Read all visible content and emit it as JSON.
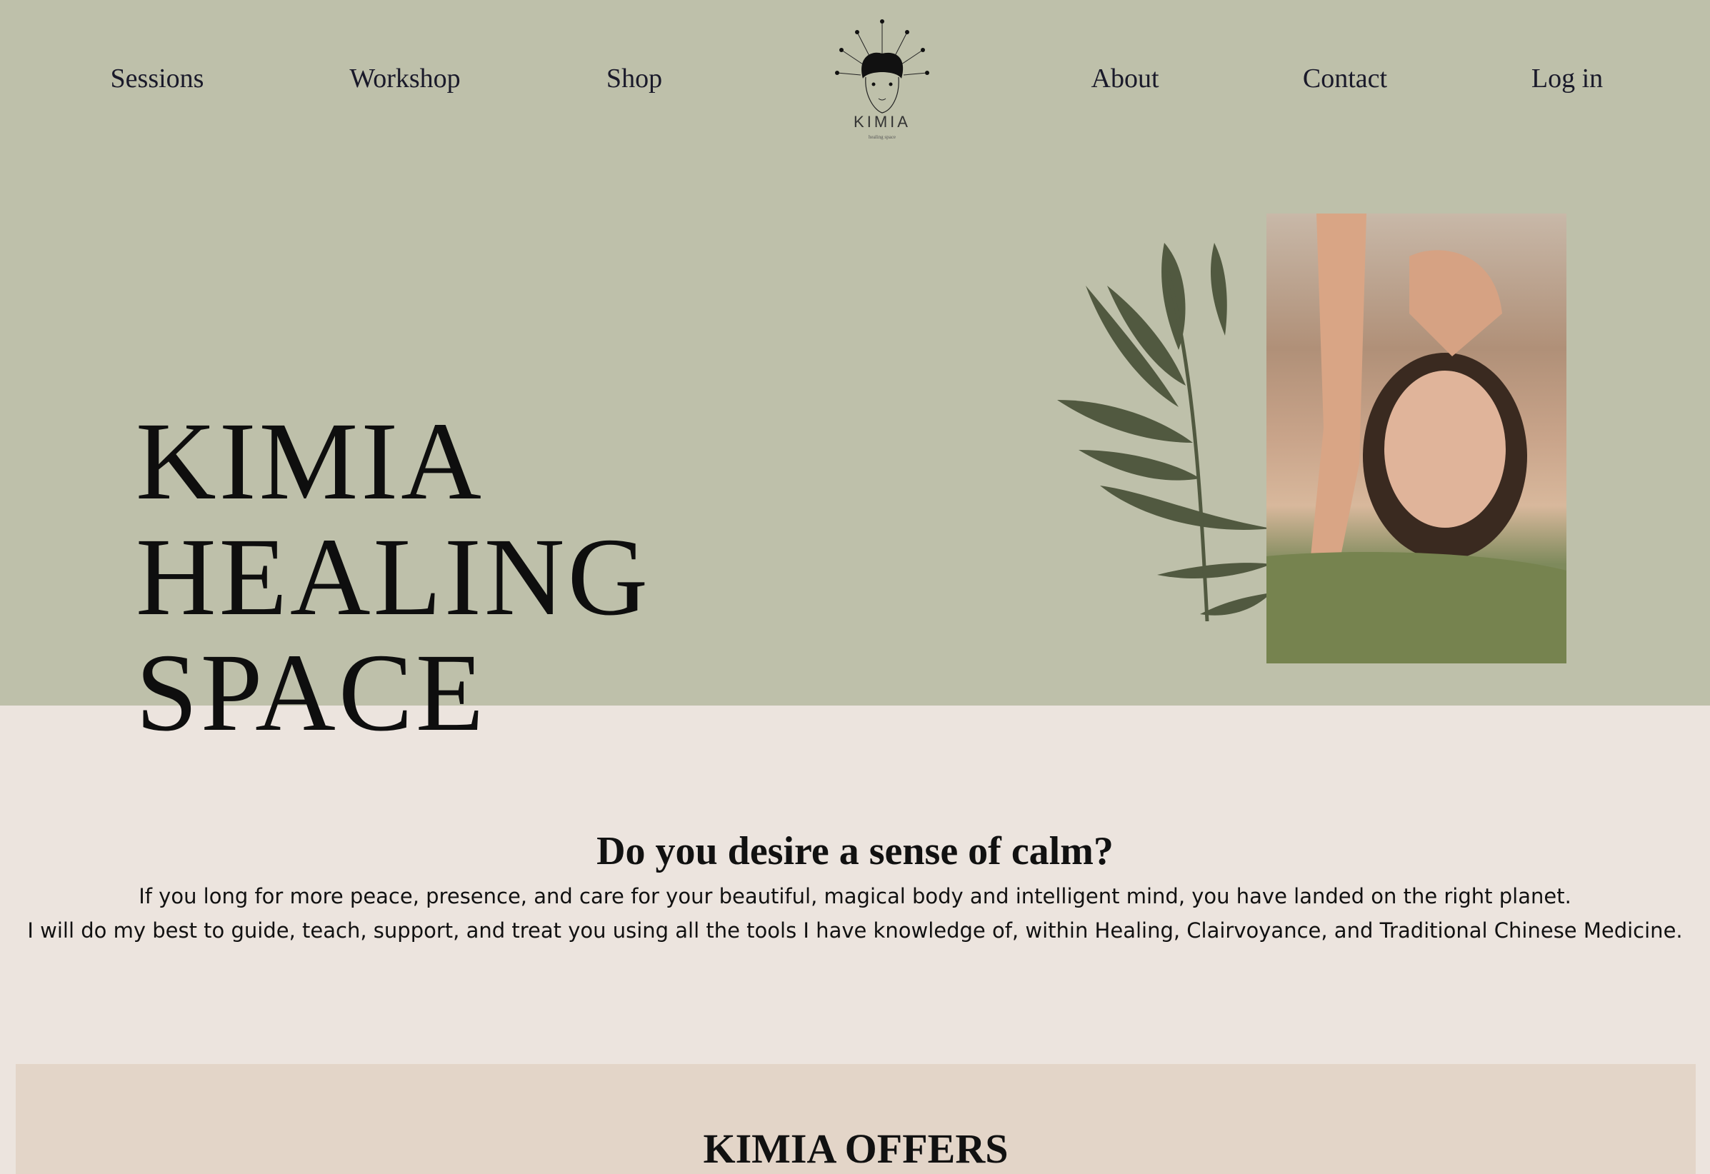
{
  "nav": {
    "left": [
      "Sessions",
      "Workshop",
      "Shop"
    ],
    "right": [
      "About",
      "Contact",
      "Log in"
    ]
  },
  "logo": {
    "text": "KIMIA",
    "tagline": "healing space"
  },
  "hero": {
    "title_lines": [
      "KIMIA",
      "HEALING",
      "SPACE"
    ]
  },
  "intro": {
    "heading": "Do you desire a sense of calm?",
    "lines": [
      "If you long for more peace, presence, and care for your beautiful, magical body and intelligent mind, you have landed on the right planet.",
      "I will do my best to guide, teach, support, and treat you using all the tools I have knowledge of, within Healing, Clairvoyance, and Traditional Chinese Medicine."
    ]
  },
  "offers": {
    "heading": "KIMIA OFFERS"
  },
  "colors": {
    "hero_bg": "#bec0aa",
    "page_bg": "#ece4de",
    "offers_bg": "#e3d5c8",
    "leaf": "#515940"
  }
}
